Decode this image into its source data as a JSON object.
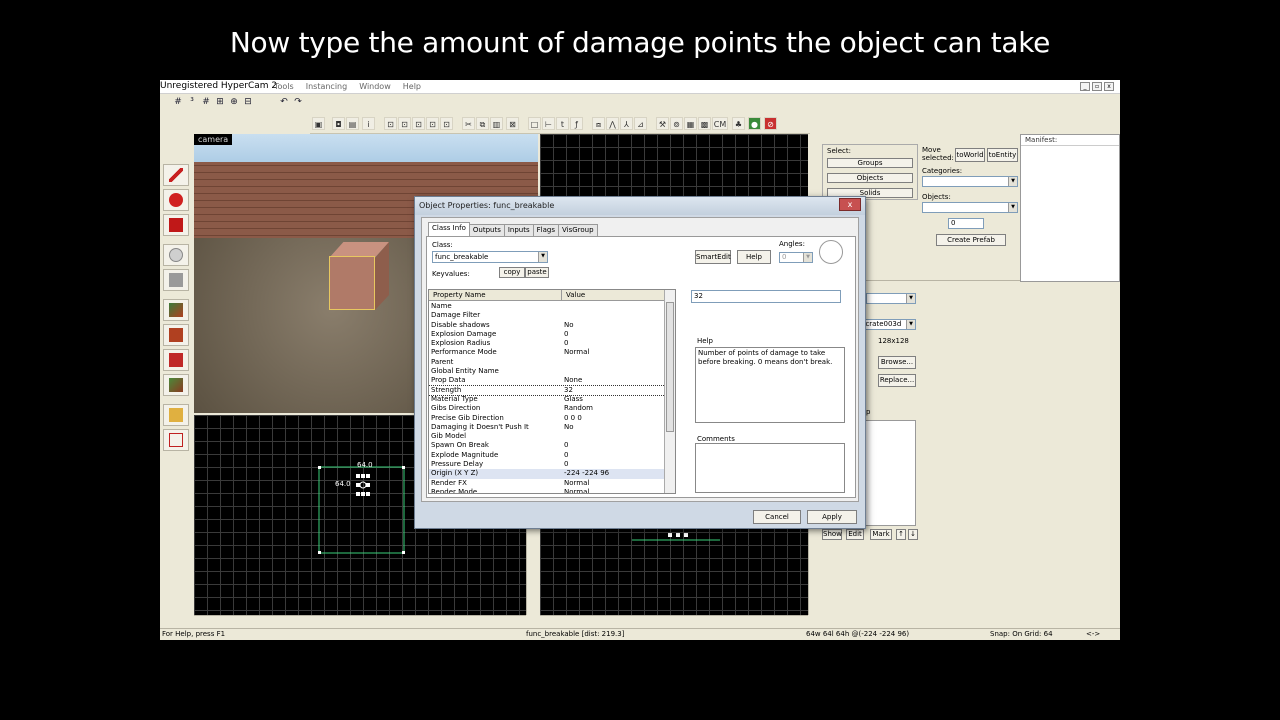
{
  "caption": "Now type the amount of damage points the object can take",
  "app": {
    "recorder_title": "Unregistered HyperCam 2",
    "menu": [
      "Tools",
      "Instancing",
      "Window",
      "Help"
    ],
    "camera_label": "camera",
    "status": {
      "help": "For Help, press F1",
      "entity": "func_breakable  [dist: 219.3]",
      "size": "64w 64l 64h @(-224 -224 96)",
      "snap": "Snap: On Grid: 64",
      "arrows": "<->"
    },
    "grid_view": {
      "width_label": "64.0",
      "height_label": "64.0"
    },
    "toolbar2_last": "CM",
    "right_panel": {
      "select_label": "Select:",
      "groups": "Groups",
      "objects": "Objects",
      "solids": "Solids",
      "move_selected": "Move selected:",
      "to_world": "toWorld",
      "to_entity": "toEntity",
      "categories": "Categories:",
      "objects_label": "Objects:",
      "objects_count": "0",
      "create_prefab": "Create Prefab",
      "manifest": "Manifest:",
      "texture_name": "dcrate003d",
      "texture_size": "128x128",
      "browse": "Browse...",
      "replace": "Replace...",
      "show": "Show",
      "edit": "Edit",
      "mark": "Mark",
      "small_p": "p"
    }
  },
  "dialog": {
    "title": "Object Properties: func_breakable",
    "close": "x",
    "tabs": [
      "Class Info",
      "Outputs",
      "Inputs",
      "Flags",
      "VisGroup"
    ],
    "class_label": "Class:",
    "class_value": "func_breakable",
    "keyvalues_label": "Keyvalues:",
    "copy": "copy",
    "paste": "paste",
    "smartedit": "SmartEdit",
    "help_button": "Help",
    "angles_label": "Angles:",
    "angles_value": "0",
    "edit_value": "32",
    "columns": [
      "Property Name",
      "Value"
    ],
    "rows": [
      {
        "k": "Name",
        "v": ""
      },
      {
        "k": "Damage Filter",
        "v": ""
      },
      {
        "k": "Disable shadows",
        "v": "No"
      },
      {
        "k": "Explosion Damage",
        "v": "0"
      },
      {
        "k": "Explosion Radius",
        "v": "0"
      },
      {
        "k": "Performance Mode",
        "v": "Normal"
      },
      {
        "k": "Parent",
        "v": ""
      },
      {
        "k": "Global Entity Name",
        "v": ""
      },
      {
        "k": "Prop Data",
        "v": "None"
      },
      {
        "k": "Strength",
        "v": "32"
      },
      {
        "k": "Material Type",
        "v": "Glass"
      },
      {
        "k": "Gibs Direction",
        "v": "Random"
      },
      {
        "k": "Precise Gib Direction",
        "v": "0 0 0"
      },
      {
        "k": "Damaging it Doesn't Push It",
        "v": "No"
      },
      {
        "k": "Gib Model",
        "v": ""
      },
      {
        "k": "Spawn On Break",
        "v": "0"
      },
      {
        "k": "Explode Magnitude",
        "v": "0"
      },
      {
        "k": "Pressure Delay",
        "v": "0"
      },
      {
        "k": "Origin (X Y Z)",
        "v": "-224 -224 96"
      },
      {
        "k": "Render FX",
        "v": "Normal"
      },
      {
        "k": "Render Mode",
        "v": "Normal"
      }
    ],
    "help_label": "Help",
    "help_text": "Number of points of damage to take before breaking.  0 means don't break.",
    "comments_label": "Comments",
    "cancel": "Cancel",
    "apply": "Apply"
  }
}
